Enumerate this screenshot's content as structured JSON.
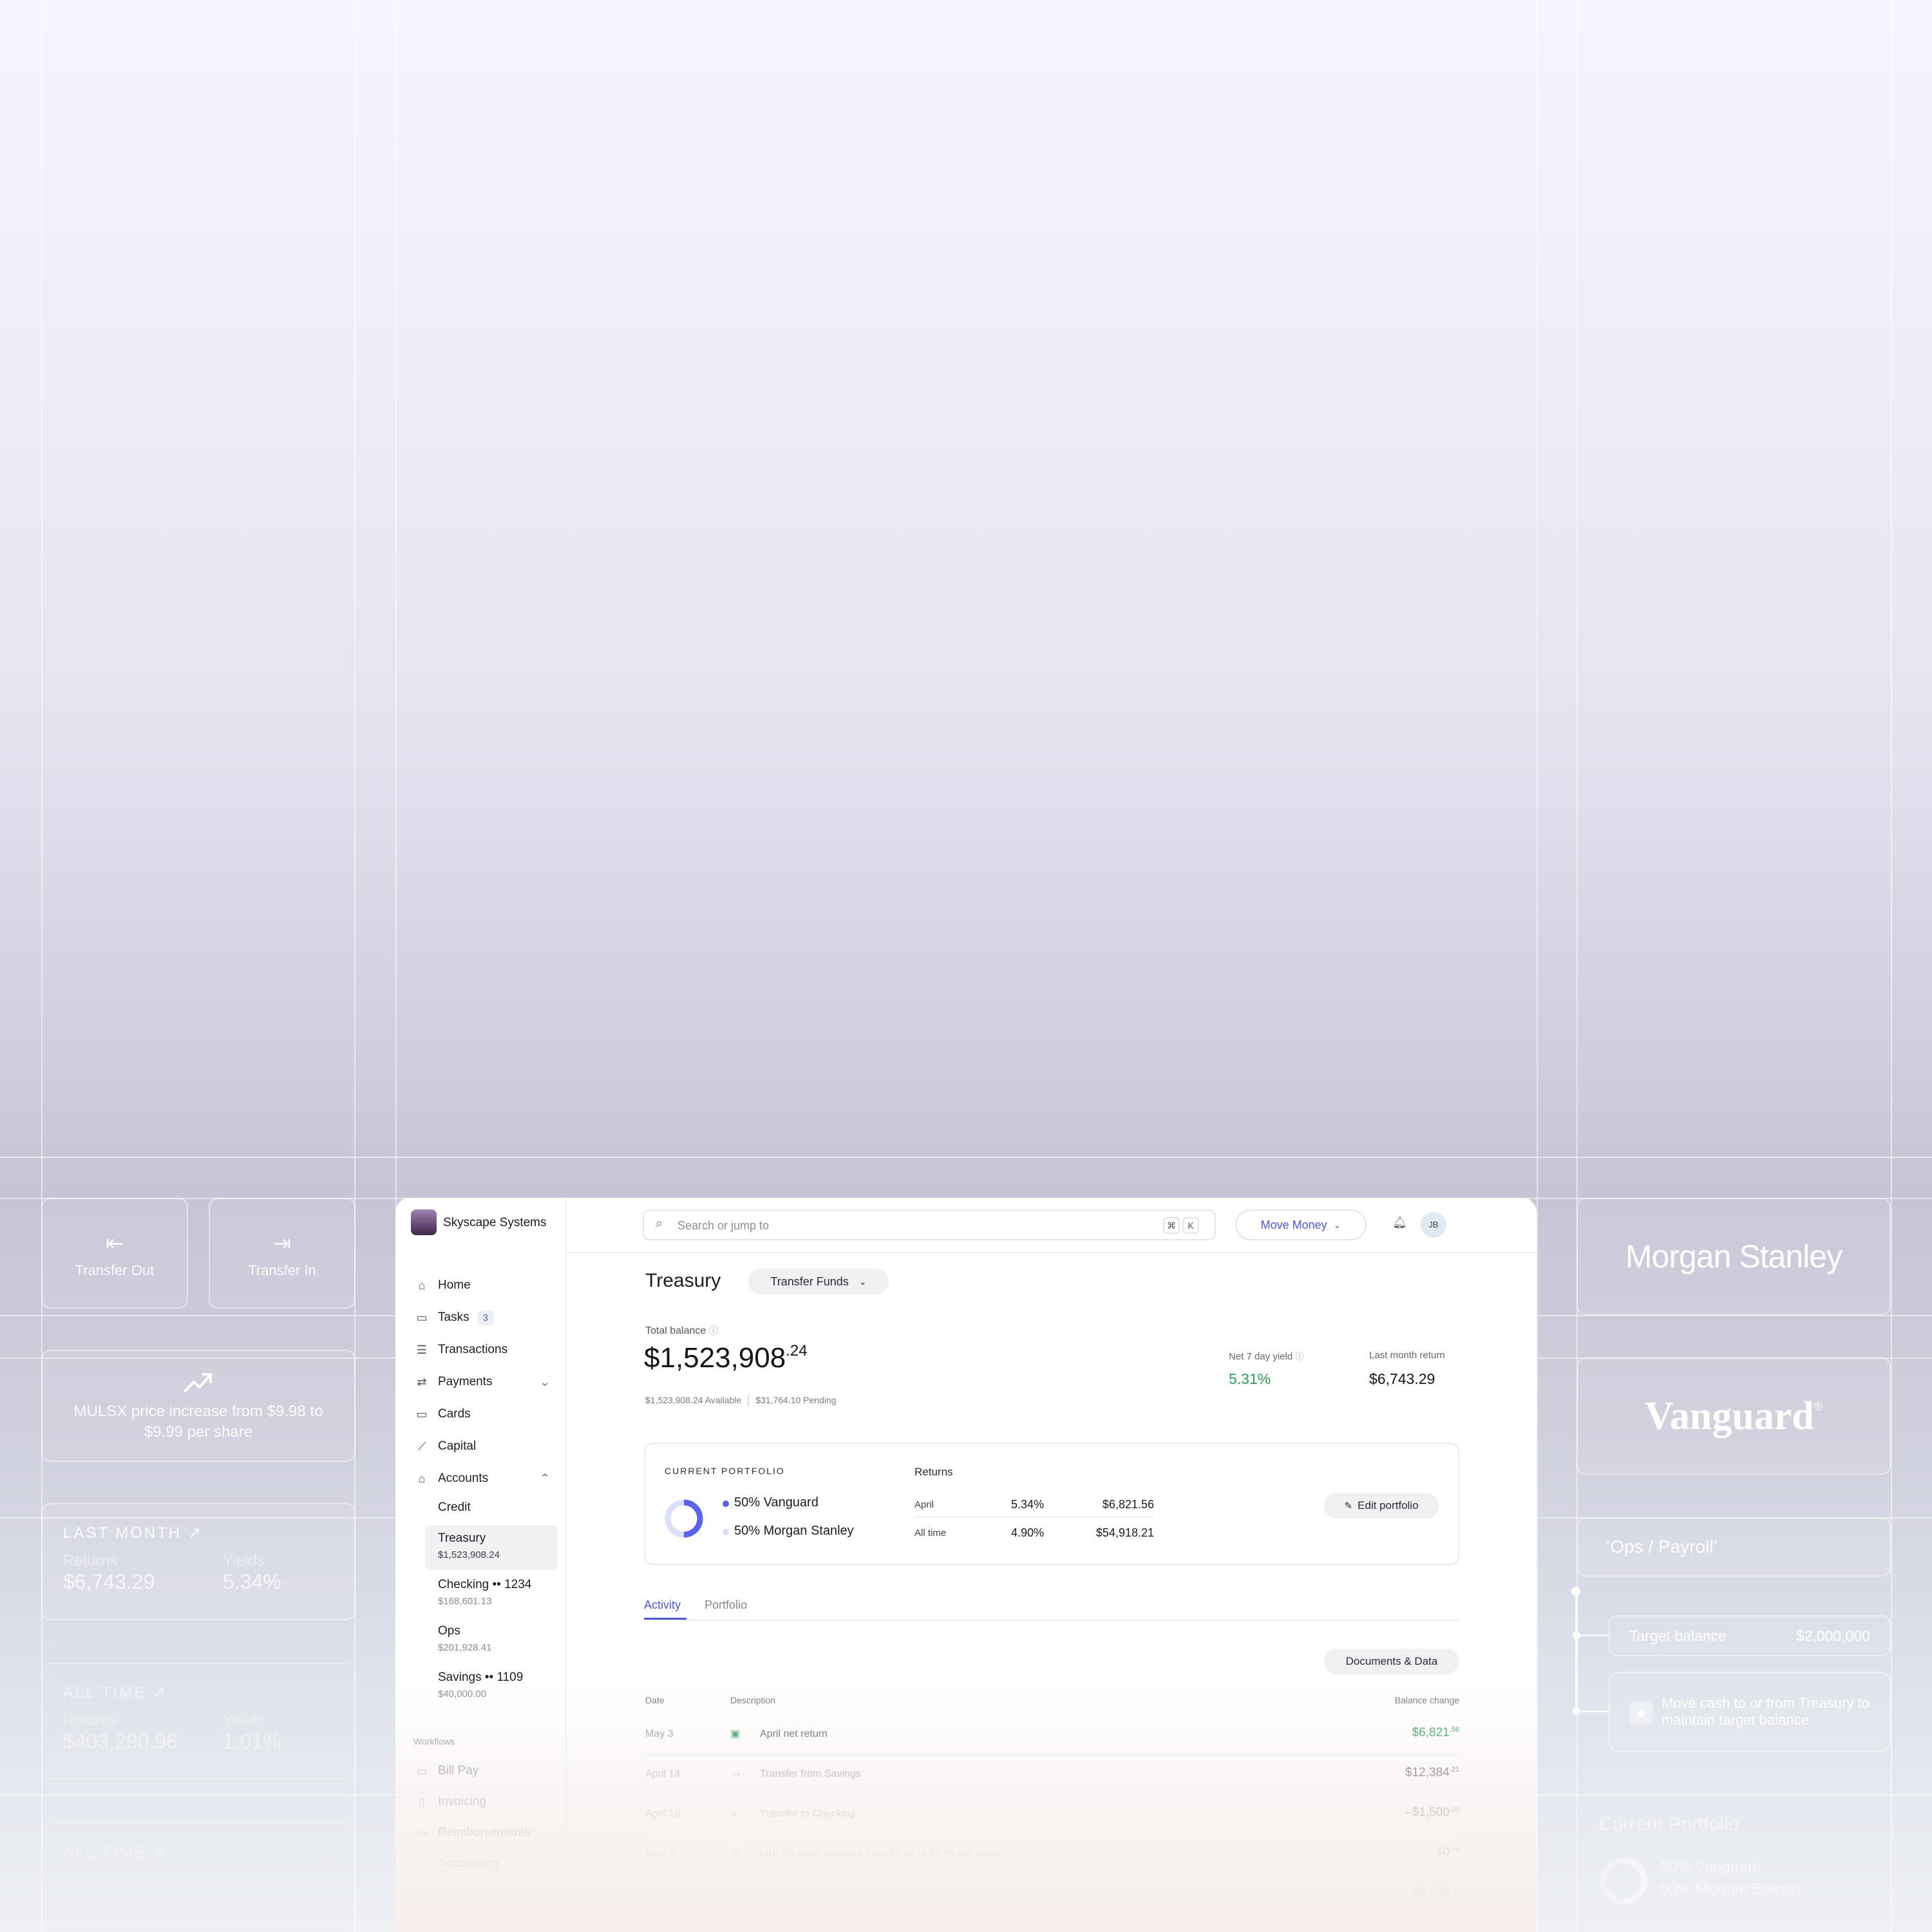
{
  "left_panels": {
    "transfer_out": "Transfer Out",
    "transfer_in": "Transfer In",
    "notice": "MULSX price increase from $9.98 to $9.99 per share",
    "last_month": {
      "header": "LAST MONTH",
      "returns_label": "Returns",
      "returns_value": "$6,743.29",
      "yields_label": "Yields",
      "yields_value": "5.34%"
    },
    "all_time": {
      "header": "ALL TIME",
      "returns_label": "Returns",
      "returns_value": "$403,290.96",
      "yields_label": "Yields",
      "yields_value": "1.01%"
    },
    "all_time_2": {
      "header": "ALL TIME"
    }
  },
  "right_panels": {
    "morgan_stanley": "Morgan Stanley",
    "vanguard": "Vanguard",
    "vanguard_mark": "®",
    "ops_payroll": "‘Ops / Payroll’",
    "target_balance_label": "Target balance",
    "target_balance_value": "$2,000,000",
    "move_cash": "Move cash to or from Treasury to maintain target balance",
    "current_portfolio": "Current Portfolio",
    "cp_vanguard": "50% Vanguard",
    "cp_ms": "50% Morgan Stanley"
  },
  "sidebar": {
    "company": "Skyscape Systems",
    "nav": [
      {
        "label": "Home",
        "icon": "home-icon",
        "glyph": "⌂"
      },
      {
        "label": "Tasks",
        "icon": "tasks-icon",
        "glyph": "▭",
        "badge": "3"
      },
      {
        "label": "Transactions",
        "icon": "list-icon",
        "glyph": "☰"
      },
      {
        "label": "Payments",
        "icon": "transfer-icon",
        "glyph": "⇄",
        "chevron": "⌄"
      },
      {
        "label": "Cards",
        "icon": "card-icon",
        "glyph": "▭"
      },
      {
        "label": "Capital",
        "icon": "chart-icon",
        "glyph": "⟋"
      },
      {
        "label": "Accounts",
        "icon": "bank-icon",
        "glyph": "⌂",
        "chevron": "⌃"
      }
    ],
    "accounts": [
      {
        "name": "Credit",
        "value": ""
      },
      {
        "name": "Treasury",
        "value": "$1,523,908.24"
      },
      {
        "name": "Checking •• 1234",
        "value": "$168,601.13"
      },
      {
        "name": "Ops",
        "value": "$201,928.41"
      },
      {
        "name": "Savings •• 1109",
        "value": "$40,000.00"
      }
    ],
    "workflows_label": "Workflows",
    "workflows": [
      "Bill Pay",
      "Invoicing",
      "Reimbursements",
      "Accounting"
    ]
  },
  "topbar": {
    "search_placeholder": "Search or jump to",
    "kbd_cmd": "⌘",
    "kbd_k": "K",
    "move_money": "Move Money",
    "avatar": "JB"
  },
  "main": {
    "title": "Treasury",
    "transfer_funds": "Transfer Funds",
    "total_balance_label": "Total balance",
    "total_balance_main": "$1,523,908",
    "total_balance_cents": ".24",
    "available": "$1,523,908.24 Available",
    "pending": "$31,764.10 Pending",
    "yield_label": "Net 7 day yield",
    "yield_value": "5.31%",
    "last_month_label": "Last month return",
    "last_month_value": "$6,743.29",
    "portfolio": {
      "header": "CURRENT PORTFOLIO",
      "vanguard": "50% Vanguard",
      "ms": "50% Morgan Stanley",
      "returns_header": "Returns",
      "rows": [
        {
          "period": "April",
          "pct": "5.34%",
          "amount": "$6,821.56"
        },
        {
          "period": "All time",
          "pct": "4.90%",
          "amount": "$54,918.21"
        }
      ],
      "edit": "Edit portfolio",
      "accent": "#5b63e8"
    },
    "tabs": [
      "Activity",
      "Portfolio"
    ],
    "documents": "Documents & Data",
    "table_headers": {
      "date": "Date",
      "description": "Description",
      "change": "Balance change"
    },
    "rows": [
      {
        "date": "May 3",
        "desc": "April net return",
        "main": "$6,821",
        "cents": ".56",
        "positive": true
      },
      {
        "date": "April 14",
        "desc": "Transfer from Savings",
        "main": "$12,384",
        "cents": ".21",
        "positive": false
      },
      {
        "date": "April 10",
        "desc": "Transfer to Checking",
        "main": "–$1,500",
        "cents": ".00",
        "positive": false
      },
      {
        "date": "April 5",
        "desc": "MULSX price increase from $9.98 to $9.99 per share",
        "main": "$0",
        "cents": ".44",
        "positive": false
      },
      {
        "date": "",
        "desc": "",
        "main": "–$2,500",
        "cents": ".00",
        "positive": false
      }
    ]
  },
  "colors": {
    "green": "#2f9a5a",
    "accent": "#4f57d6",
    "logo": "#6b4e7a"
  }
}
